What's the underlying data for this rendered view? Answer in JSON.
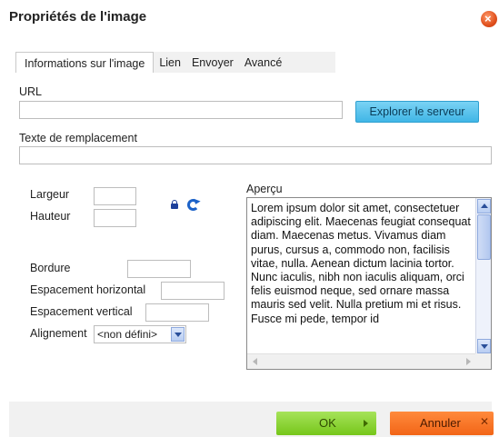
{
  "dialog": {
    "title": "Propriétés de l'image",
    "close_icon": "close-icon"
  },
  "tabs": [
    {
      "label": "Informations sur l'image",
      "active": true
    },
    {
      "label": "Lien",
      "active": false
    },
    {
      "label": "Envoyer",
      "active": false
    },
    {
      "label": "Avancé",
      "active": false
    }
  ],
  "fields": {
    "url_label": "URL",
    "url_value": "",
    "browse_label": "Explorer le serveur",
    "alt_label": "Texte de remplacement",
    "alt_value": "",
    "width_label": "Largeur",
    "width_value": "",
    "height_label": "Hauteur",
    "height_value": "",
    "border_label": "Bordure",
    "border_value": "",
    "hspace_label": "Espacement horizontal",
    "hspace_value": "",
    "vspace_label": "Espacement vertical",
    "vspace_value": "",
    "align_label": "Alignement",
    "align_value": "<non défini>"
  },
  "preview": {
    "label": "Aperçu",
    "text": "Lorem ipsum dolor sit amet, consectetuer adipiscing elit. Maecenas feugiat consequat diam. Maecenas metus. Vivamus diam purus, cursus a, commodo non, facilisis vitae, nulla. Aenean dictum lacinia tortor. Nunc iaculis, nibh non iaculis aliquam, orci felis euismod neque, sed ornare massa mauris sed velit. Nulla pretium mi et risus. Fusce mi pede, tempor id"
  },
  "footer": {
    "ok_label": "OK",
    "cancel_label": "Annuler"
  },
  "colors": {
    "ok_button": "#8ad43a",
    "cancel_button": "#f47a2a",
    "browse_button": "#5cc5ef",
    "close_button": "#e85a22"
  },
  "icons": [
    "lock-icon",
    "reset-size-icon",
    "close-icon",
    "chevron-down-icon"
  ]
}
